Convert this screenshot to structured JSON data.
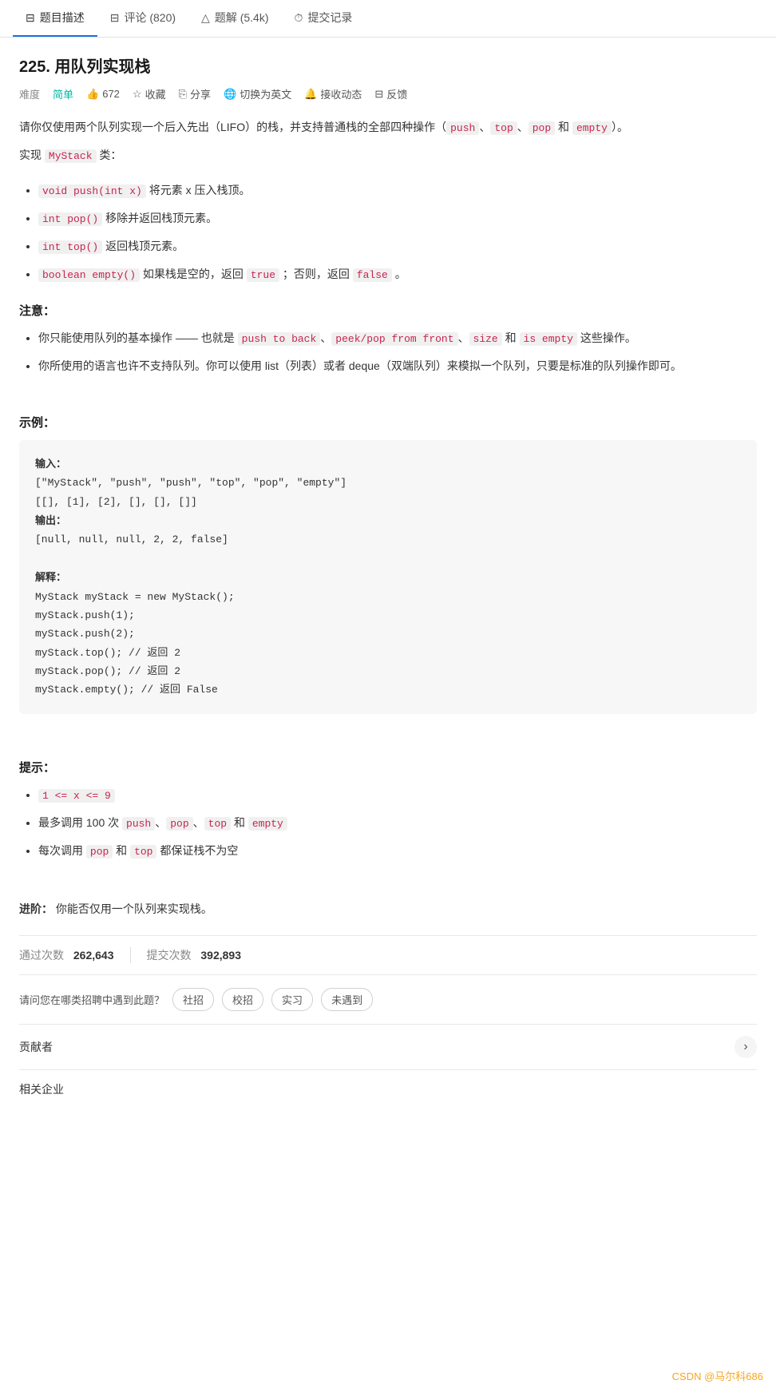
{
  "nav": {
    "tabs": [
      {
        "id": "description",
        "icon": "📋",
        "label": "题目描述",
        "active": true
      },
      {
        "id": "comments",
        "icon": "💬",
        "label": "评论 (820)",
        "active": false
      },
      {
        "id": "solutions",
        "icon": "🔺",
        "label": "题解 (5.4k)",
        "active": false
      },
      {
        "id": "submissions",
        "icon": "⏱",
        "label": "提交记录",
        "active": false
      }
    ]
  },
  "problem": {
    "title": "225. 用队列实现栈",
    "difficulty_label": "难度",
    "difficulty": "简单",
    "likes": "672",
    "collect": "收藏",
    "share": "分享",
    "switch_lang": "切换为英文",
    "subscribe": "接收动态",
    "feedback": "反馈"
  },
  "description": {
    "intro": "请你仅使用两个队列实现一个后入先出（LIFO）的栈，并支持普通栈的全部四种操作（push、top、pop 和 empty）。",
    "implement": "实现 MyStack 类：",
    "methods": [
      {
        "code": "void push(int x)",
        "desc": "将元素 x 压入栈顶。"
      },
      {
        "code": "int pop()",
        "desc": "移除并返回栈顶元素。"
      },
      {
        "code": "int top()",
        "desc": "返回栈顶元素。"
      },
      {
        "code": "boolean empty()",
        "desc": "如果栈是空的，返回 true ；否则，返回 false 。"
      }
    ],
    "note_heading": "注意：",
    "notes": [
      {
        "text_before": "你只能使用队列的基本操作 —— 也就是 ",
        "code1": "push to back",
        "text_mid1": "、",
        "code2": "peek/pop from front",
        "text_mid2": "、",
        "code3": "size",
        "text_mid3": " 和 ",
        "code4": "is empty",
        "text_after": " 这些操作。"
      },
      {
        "text_before": "你所使用的语言也许不支持队列。你可以使用 list（列表）或者 deque（双端队列）来模拟一个队列，只要是标准的队列操作即可。"
      }
    ],
    "example_heading": "示例：",
    "example": {
      "input_label": "输入：",
      "input1": "[\"MyStack\", \"push\", \"push\", \"top\", \"pop\", \"empty\"]",
      "input2": "[[], [1], [2], [], [], []]",
      "output_label": "输出：",
      "output": "[null, null, null, 2, 2, false]",
      "explain_label": "解释：",
      "explain_lines": [
        "MyStack myStack = new MyStack();",
        "myStack.push(1);",
        "myStack.push(2);",
        "myStack.top();   // 返回 2",
        "myStack.pop();   // 返回 2",
        "myStack.empty(); // 返回 False"
      ]
    },
    "hints_heading": "提示：",
    "hints": [
      "1 <= x <= 9",
      "最多调用 100 次 push、pop、top 和 empty",
      "每次调用 pop 和 top 都保证栈不为空"
    ],
    "advanced_heading": "进阶：",
    "advanced_text": "你能否仅用一个队列来实现栈。"
  },
  "stats": {
    "pass_label": "通过次数",
    "pass_value": "262,643",
    "submit_label": "提交次数",
    "submit_value": "392,893"
  },
  "tags": {
    "question_label": "请问您在哪类招聘中遇到此题？",
    "items": [
      "社招",
      "校招",
      "实习",
      "未遇到"
    ]
  },
  "contributors": {
    "label": "贡献者"
  },
  "related": {
    "label": "相关企业"
  },
  "watermark": "CSDN @马尔科686"
}
